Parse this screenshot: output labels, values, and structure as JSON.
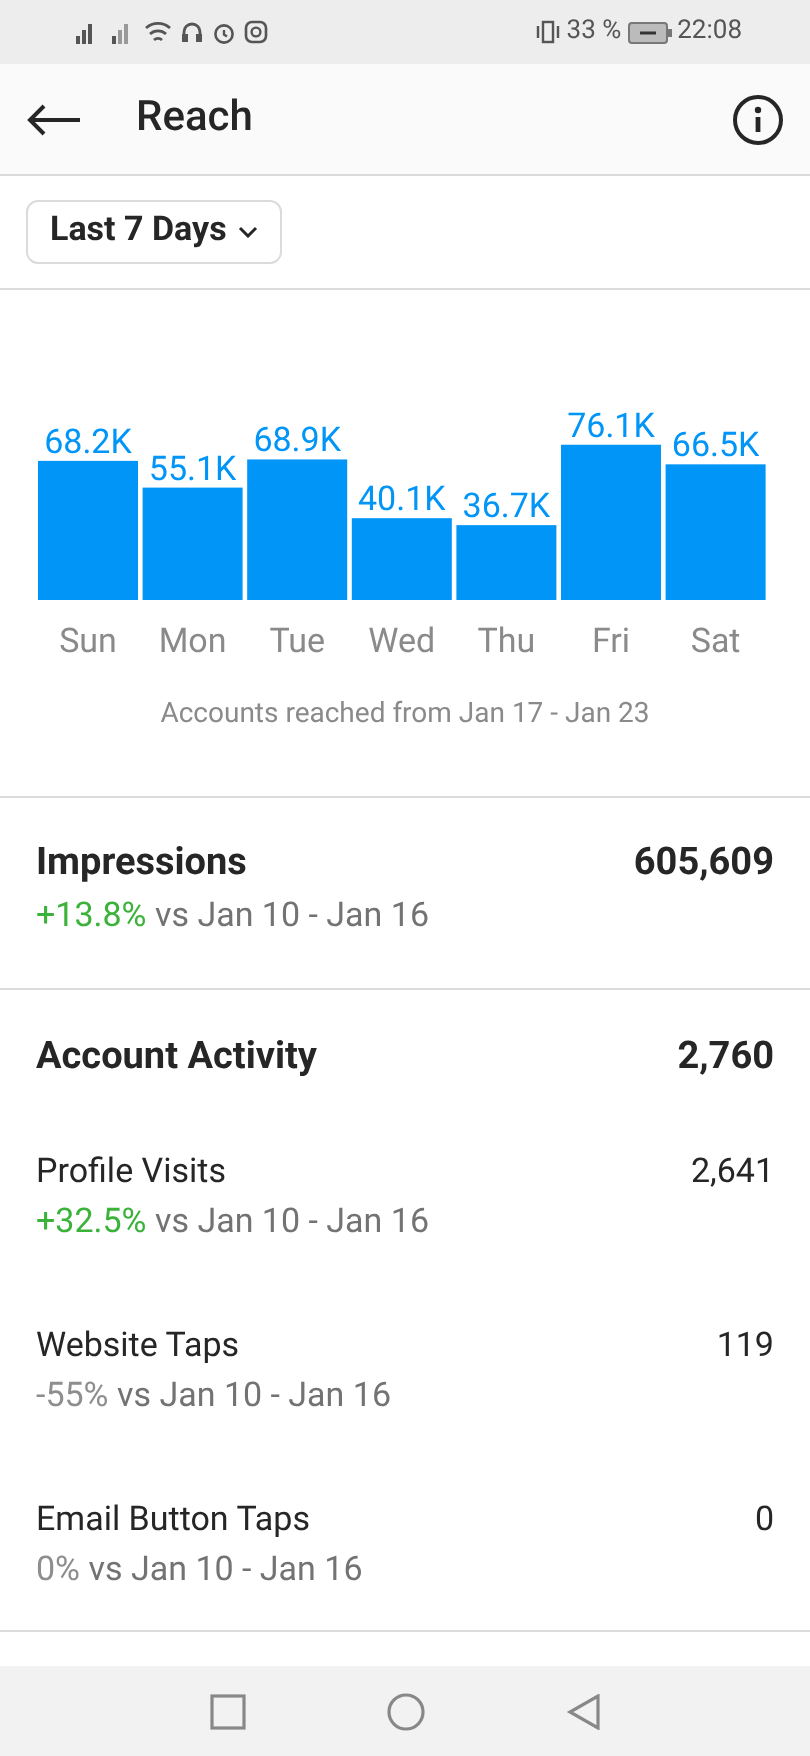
{
  "status_bar": {
    "battery": "33 %",
    "time": "22:08"
  },
  "header": {
    "title": "Reach"
  },
  "filter": {
    "label": "Last 7 Days"
  },
  "reach": {
    "chart_data": {
      "type": "bar",
      "categories": [
        "Sun",
        "Mon",
        "Tue",
        "Wed",
        "Thu",
        "Fri",
        "Sat"
      ],
      "values": [
        68.2,
        55.1,
        68.9,
        40.1,
        36.7,
        76.1,
        66.5
      ],
      "value_labels": [
        "68.2K",
        "55.1K",
        "68.9K",
        "40.1K",
        "36.7K",
        "76.1K",
        "66.5K"
      ]
    },
    "caption": "Accounts reached from Jan 17 - Jan 23"
  },
  "impressions": {
    "label": "Impressions",
    "value": "605,609",
    "change": "+13.8%",
    "positive": true,
    "comparison": "vs Jan 10 - Jan 16"
  },
  "account_activity": {
    "label": "Account Activity",
    "value": "2,760",
    "items": [
      {
        "label": "Profile Visits",
        "value": "2,641",
        "change": "+32.5%",
        "positive": true,
        "comparison": "vs Jan 10 - Jan 16"
      },
      {
        "label": "Website Taps",
        "value": "119",
        "change": "-55%",
        "positive": false,
        "comparison": "vs Jan 10 - Jan 16"
      },
      {
        "label": "Email Button Taps",
        "value": "0",
        "change": "0%",
        "positive": false,
        "comparison": "vs Jan 10 - Jan 16"
      }
    ]
  }
}
